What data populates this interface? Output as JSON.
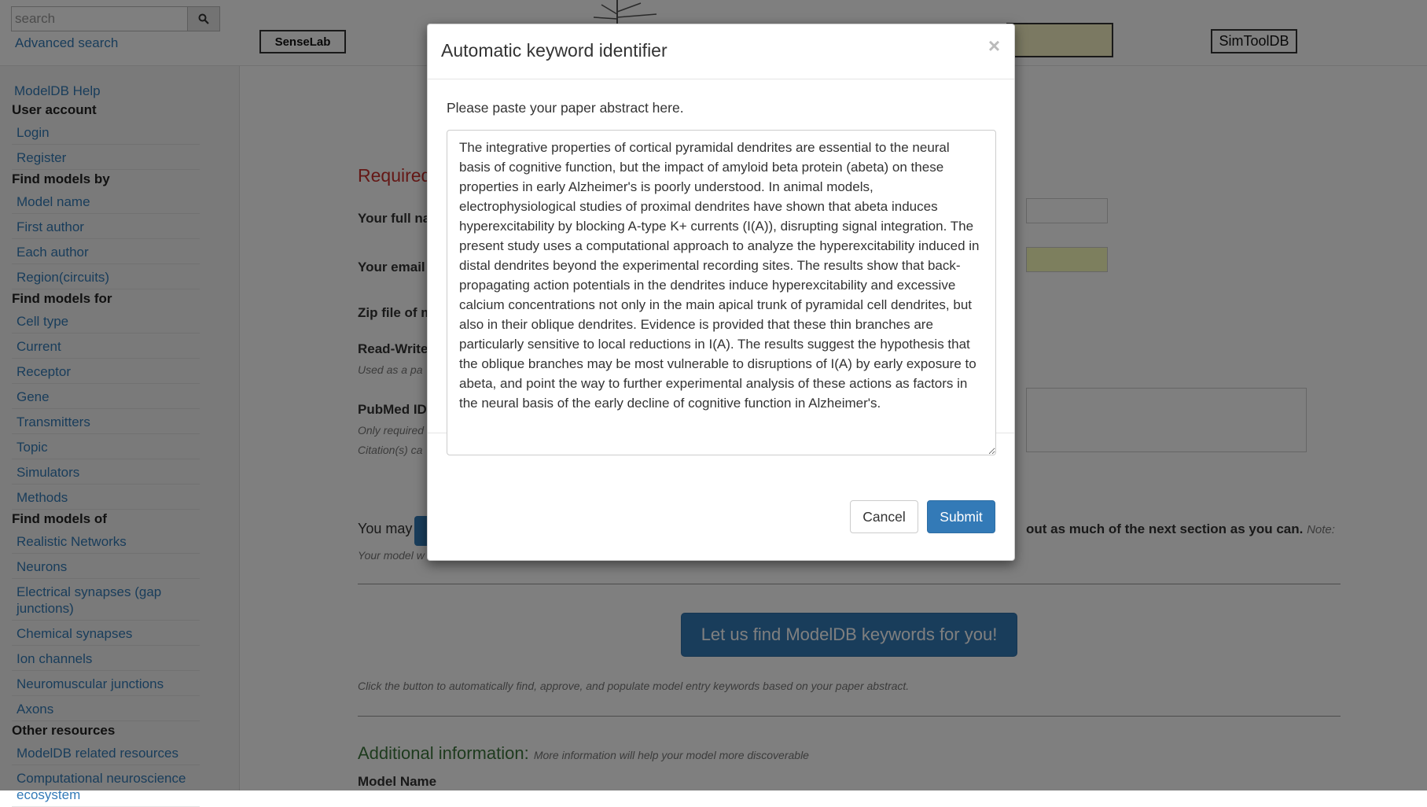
{
  "header": {
    "search_placeholder": "search",
    "advanced_search": "Advanced search",
    "logos": {
      "senselab": "SenseLab",
      "simtooldb": "SimToolDB"
    }
  },
  "sidebar": {
    "help": "ModelDB Help",
    "sections": [
      {
        "title": "User account",
        "items": [
          "Login",
          "Register"
        ]
      },
      {
        "title": "Find models by",
        "items": [
          "Model name",
          "First author",
          "Each author",
          "Region(circuits)"
        ]
      },
      {
        "title": "Find models for",
        "items": [
          "Cell type",
          "Current",
          "Receptor",
          "Gene",
          "Transmitters",
          "Topic",
          "Simulators",
          "Methods"
        ]
      },
      {
        "title": "Find models of",
        "items": [
          "Realistic Networks",
          "Neurons",
          "Electrical synapses (gap junctions)",
          "Chemical synapses",
          "Ion channels",
          "Neuromuscular junctions",
          "Axons"
        ]
      },
      {
        "title": "Other resources",
        "items": [
          "ModelDB related resources",
          "Computational neuroscience ecosystem"
        ]
      }
    ]
  },
  "main": {
    "required_title": "Required",
    "full_name_label": "Your full na",
    "email_label": "Your email",
    "zip_label": "Zip file of m",
    "readwrite_label": "Read-Write",
    "readwrite_hint": "Used as a pa",
    "pubmed_label": "PubMed ID",
    "pubmed_hint1": "Only required",
    "pubmed_hint2": "Citation(s) ca",
    "you_may": "You may",
    "fill_out": "out as much of the next section as you can.",
    "fill_out_note": "Note:",
    "model_hint": "Your model w",
    "find_keywords_button": "Let us find ModelDB keywords for you!",
    "click_hint": "Click the button to automatically find, approve, and populate model entry keywords based on your paper abstract.",
    "additional_title": "Additional information:",
    "additional_hint": "More information will help your model more discoverable",
    "model_name_label": "Model Name"
  },
  "modal": {
    "title": "Automatic keyword identifier",
    "close_symbol": "×",
    "paste_label": "Please paste your paper abstract here.",
    "abstract": "The integrative properties of cortical pyramidal dendrites are essential to the neural basis of cognitive function, but the impact of amyloid beta protein (abeta) on these properties in early Alzheimer's is poorly understood. In animal models, electrophysiological studies of proximal dendrites have shown that abeta induces hyperexcitability by blocking A-type K+ currents (I(A)), disrupting signal integration. The present study uses a computational approach to analyze the hyperexcitability induced in distal dendrites beyond the experimental recording sites. The results show that back-propagating action potentials in the dendrites induce hyperexcitability and excessive calcium concentrations not only in the main apical trunk of pyramidal cell dendrites, but also in their oblique dendrites. Evidence is provided that these thin branches are particularly sensitive to local reductions in I(A). The results suggest the hypothesis that the oblique branches may be most vulnerable to disruptions of I(A) by early exposure to abeta, and point the way to further experimental analysis of these actions as factors in the neural basis of the early decline of cognitive function in Alzheimer's.",
    "cancel": "Cancel",
    "submit": "Submit"
  },
  "colors": {
    "primary": "#337ab7",
    "required": "#c9302c",
    "additional": "#3c763d"
  }
}
